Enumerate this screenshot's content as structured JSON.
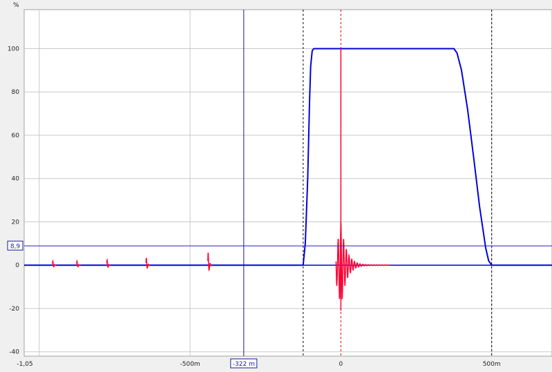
{
  "chart_data": {
    "type": "line",
    "ylabel": "%",
    "xlim": [
      -1.05,
      0.7
    ],
    "ylim": [
      -42,
      118
    ],
    "grid": true,
    "y_ticks": [
      100,
      80,
      60,
      40,
      20,
      0,
      -20,
      -40
    ],
    "y_tick_labels": [
      "100",
      "80",
      "60",
      "40",
      "20",
      "0",
      "-20",
      "-40"
    ],
    "x_ticks": [
      -1.05,
      -0.5,
      0,
      0.5
    ],
    "x_tick_labels": [
      "-1,05",
      "-500m",
      "0",
      "500m"
    ],
    "x_gridlines": [
      -1.0,
      -0.5,
      0.5
    ],
    "cursor_x": {
      "value": -0.322,
      "label": "-322 m"
    },
    "cursor_y": {
      "value": 8.9,
      "label": "8,9"
    },
    "markers": [
      {
        "x": -0.125,
        "style": "dashed",
        "color": "#000000"
      },
      {
        "x": 0.0,
        "style": "dashed",
        "color": "#e00000"
      },
      {
        "x": 0.5,
        "style": "dashed",
        "color": "#000000"
      }
    ],
    "series": [
      {
        "color": "#0000dd",
        "x": [
          -1.05,
          -0.125,
          -0.118,
          -0.11,
          -0.104,
          -0.1,
          -0.095,
          -0.09,
          0.0,
          0.35,
          0.375,
          0.385,
          0.4,
          0.42,
          0.44,
          0.46,
          0.48,
          0.49,
          0.5,
          0.7
        ],
        "values": [
          0,
          0,
          10,
          40,
          75,
          92,
          99,
          100,
          100,
          100,
          100,
          98,
          90,
          72,
          50,
          27,
          8,
          2,
          0,
          0
        ]
      },
      {
        "color": "#ff0033",
        "spikes": [
          {
            "x": -0.955,
            "amp": 2
          },
          {
            "x": -0.875,
            "amp": 2
          },
          {
            "x": -0.775,
            "amp": 2.5
          },
          {
            "x": -0.645,
            "amp": 3.5
          },
          {
            "x": -0.44,
            "amp": 6
          },
          {
            "x": 0.0,
            "amp": 20
          }
        ]
      }
    ]
  }
}
